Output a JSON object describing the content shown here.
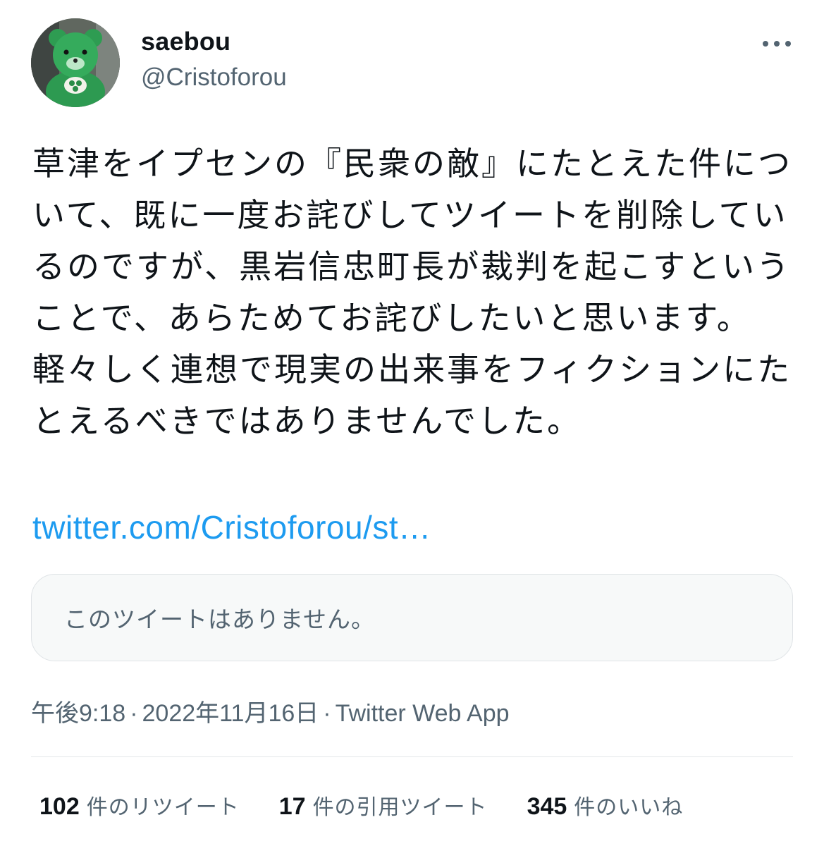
{
  "user": {
    "display_name": "saebou",
    "handle": "@Cristoforou"
  },
  "tweet": {
    "text": "草津をイプセンの『民衆の敵』にたとえた件について、既に一度お詫びしてツイートを削除しているのですが、黒岩信忠町長が裁判を起こすということで、あらためてお詫びしたいと思います。軽々しく連想で現実の出来事をフィクションにたとえるべきではありませんでした。",
    "link": "twitter.com/Cristoforou/st…",
    "quoted_unavailable": "このツイートはありません。"
  },
  "meta": {
    "time": "午後9:18",
    "separator": "·",
    "date": "2022年11月16日",
    "source": "Twitter Web App"
  },
  "stats": [
    {
      "count": "102",
      "label": "件のリツイート"
    },
    {
      "count": "17",
      "label": "件の引用ツイート"
    },
    {
      "count": "345",
      "label": "件のいいね"
    }
  ],
  "icons": {
    "more": "more-horizontal-icon"
  },
  "colors": {
    "link": "#1d9bf0",
    "secondary_text": "#536471",
    "card_bg": "#f7f9f9"
  }
}
